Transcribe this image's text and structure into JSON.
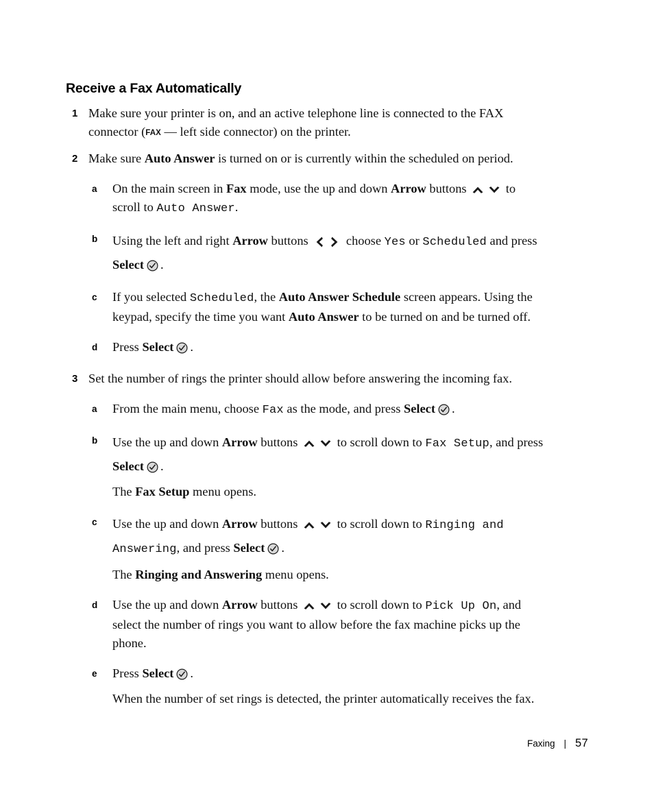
{
  "document": {
    "heading": "Receive a Fax Automatically"
  },
  "steps": [
    {
      "number": "1",
      "parts": [
        {
          "type": "text",
          "value": "Make sure your printer is on, and an active telephone line is connected to the FAX connector ("
        },
        {
          "type": "fax-label",
          "value": "FAX"
        },
        {
          "type": "text",
          "value": " — left side connector) on the printer."
        }
      ]
    },
    {
      "number": "2",
      "parts": [
        {
          "type": "text",
          "value": "Make sure "
        },
        {
          "type": "bold",
          "value": "Auto Answer"
        },
        {
          "type": "text",
          "value": " is turned on or is currently within the scheduled on period."
        }
      ]
    },
    {
      "number": "3",
      "parts": [
        {
          "type": "text",
          "value": "Set the number of rings the printer should allow before answering the incoming fax."
        }
      ]
    }
  ],
  "group2": {
    "a": {
      "letter": "a",
      "t1": "On the main screen in ",
      "b1": "Fax",
      "t2": " mode, use the up and down ",
      "b2": "Arrow",
      "t3": " buttons ",
      "t4": " to scroll to ",
      "m1": "Auto Answer",
      "t5": "."
    },
    "b": {
      "letter": "b",
      "t1": "Using the left and right ",
      "b1": "Arrow",
      "t2": " buttons ",
      "t3": " choose ",
      "m1": "Yes",
      "t4": " or ",
      "m2": "Scheduled",
      "t5": " and press ",
      "b2": "Select",
      "t6": "."
    },
    "c": {
      "letter": "c",
      "t1": "If you selected ",
      "m1": "Scheduled",
      "t2": ", the ",
      "b1": "Auto Answer Schedule",
      "t3": " screen appears. Using the keypad, specify the time you want ",
      "b2": "Auto Answer",
      "t4": " to be turned on and be turned off."
    },
    "d": {
      "letter": "d",
      "t1": "Press ",
      "b1": "Select",
      "t2": "."
    }
  },
  "group3": {
    "a": {
      "letter": "a",
      "t1": "From the main menu, choose ",
      "m1": "Fax",
      "t2": " as the mode, and press ",
      "b1": "Select",
      "t3": "."
    },
    "b": {
      "letter": "b",
      "t1": "Use the up and down ",
      "b1": "Arrow",
      "t2": " buttons ",
      "t3": " to scroll down to ",
      "m1": "Fax Setup",
      "t4": ", and press ",
      "b2": "Select",
      "t5": ".",
      "note_t1": "The ",
      "note_b1": "Fax Setup",
      "note_t2": " menu opens."
    },
    "c": {
      "letter": "c",
      "t1": "Use the up and down ",
      "b1": "Arrow",
      "t2": " buttons ",
      "t3": " to scroll down to ",
      "m1": "Ringing and Answering",
      "t4": ", and press ",
      "b2": "Select",
      "t5": ".",
      "note_t1": "The ",
      "note_b1": "Ringing and Answering",
      "note_t2": " menu opens."
    },
    "d": {
      "letter": "d",
      "t1": "Use the up and down ",
      "b1": "Arrow",
      "t2": " buttons ",
      "t3": " to scroll down to ",
      "m1": "Pick Up On",
      "t4": ", and select the number of rings you want to allow before the fax machine picks up the phone."
    },
    "e": {
      "letter": "e",
      "t1": "Press ",
      "b1": "Select",
      "t2": ".",
      "note": "When the number of set rings is detected, the printer automatically receives the fax."
    }
  },
  "icons": {
    "arrow_up": "arrow-up-icon",
    "arrow_down": "arrow-down-icon",
    "arrow_left": "arrow-left-icon",
    "arrow_right": "arrow-right-icon",
    "select": "select-check-icon"
  },
  "footer": {
    "chapter": "Faxing",
    "separator": "|",
    "page": "57"
  },
  "colors": {
    "text": "#111111",
    "icon_fill": "#d9d9d9",
    "icon_stroke": "#1a1a1a",
    "background": "#ffffff"
  }
}
